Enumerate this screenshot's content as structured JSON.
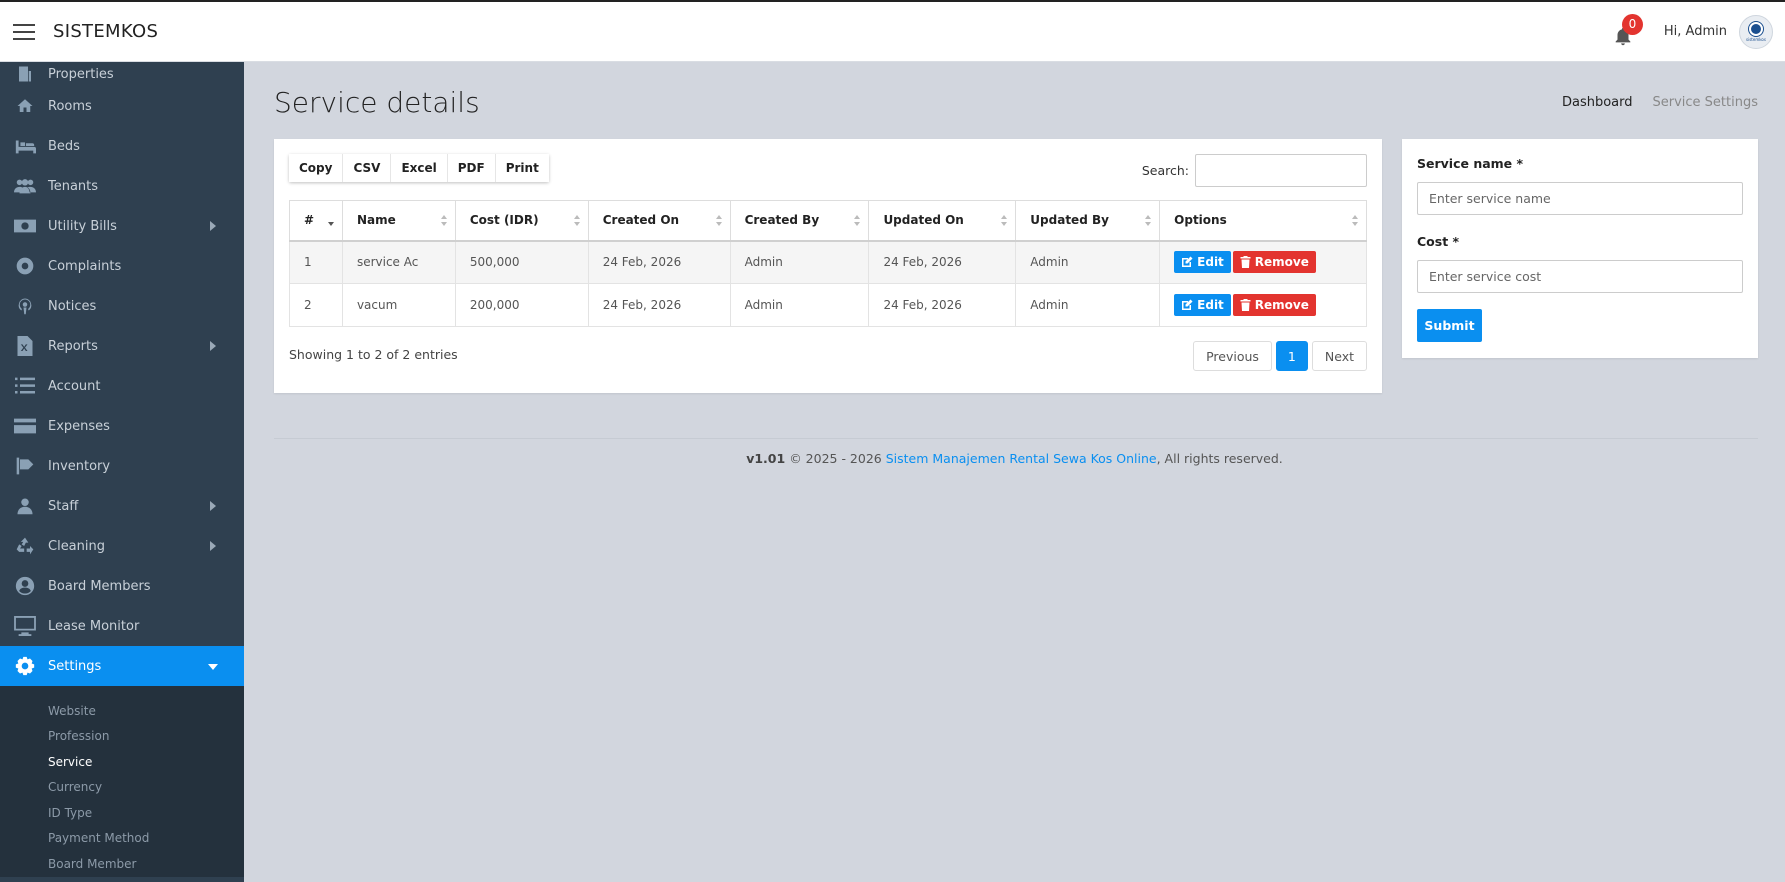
{
  "topbar": {
    "brand": "SISTEMKOS",
    "notification_count": "0",
    "greeting": "Hi, Admin",
    "avatar_text": "sistemkos"
  },
  "sidebar": {
    "items": [
      {
        "label": "Properties",
        "icon": "building-icon"
      },
      {
        "label": "Rooms",
        "icon": "home-icon"
      },
      {
        "label": "Beds",
        "icon": "bed-icon"
      },
      {
        "label": "Tenants",
        "icon": "users-icon"
      },
      {
        "label": "Utility Bills",
        "icon": "money-icon"
      },
      {
        "label": "Complaints",
        "icon": "lifebuoy-icon"
      },
      {
        "label": "Notices",
        "icon": "podcast-icon"
      },
      {
        "label": "Reports",
        "icon": "excel-file-icon"
      },
      {
        "label": "Account",
        "icon": "list-icon"
      },
      {
        "label": "Expenses",
        "icon": "credit-card-icon"
      },
      {
        "label": "Inventory",
        "icon": "tag-icon"
      },
      {
        "label": "Staff",
        "icon": "user-icon"
      },
      {
        "label": "Cleaning",
        "icon": "recycle-icon"
      },
      {
        "label": "Board Members",
        "icon": "user-circle-icon"
      },
      {
        "label": "Lease Monitor",
        "icon": "monitor-icon"
      },
      {
        "label": "Settings",
        "icon": "gear-icon"
      }
    ],
    "submenu": [
      "Website",
      "Profession",
      "Service",
      "Currency",
      "ID Type",
      "Payment Method",
      "Board Member"
    ]
  },
  "page": {
    "title": "Service details",
    "breadcrumb": [
      "Dashboard",
      "Service Settings"
    ]
  },
  "table": {
    "buttons": [
      "Copy",
      "CSV",
      "Excel",
      "PDF",
      "Print"
    ],
    "search_label": "Search:",
    "search_value": "",
    "columns": [
      "#",
      "Name",
      "Cost (IDR)",
      "Created On",
      "Created By",
      "Updated On",
      "Updated By",
      "Options"
    ],
    "rows": [
      {
        "num": "1",
        "name": "service Ac",
        "cost": "500,000",
        "created_on": "24 Feb, 2026",
        "created_by": "Admin",
        "updated_on": "24 Feb, 2026",
        "updated_by": "Admin"
      },
      {
        "num": "2",
        "name": "vacum",
        "cost": "200,000",
        "created_on": "24 Feb, 2026",
        "created_by": "Admin",
        "updated_on": "24 Feb, 2026",
        "updated_by": "Admin"
      }
    ],
    "edit_label": "Edit",
    "remove_label": "Remove",
    "info": "Showing 1 to 2 of 2 entries",
    "pager": {
      "previous": "Previous",
      "current": "1",
      "next": "Next"
    }
  },
  "form": {
    "service_name_label": "Service name *",
    "service_name_placeholder": "Enter service name",
    "cost_label": "Cost *",
    "cost_placeholder": "Enter service cost",
    "submit_label": "Submit"
  },
  "footer": {
    "version": "v1.01",
    "copyright": "© 2025 - 2026",
    "link": "Sistem Manajemen Rental Sewa Kos Online",
    "rights": ", All rights reserved."
  },
  "colors": {
    "accent": "#0a8ff0",
    "danger": "#e3342f",
    "sidebar": "#2f4050",
    "background": "#d2d6de"
  }
}
